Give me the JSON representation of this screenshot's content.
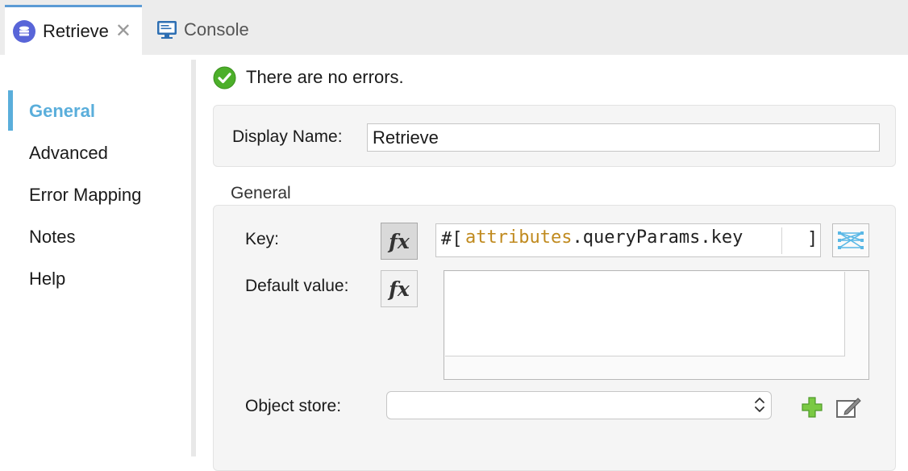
{
  "tabs": [
    {
      "label": "Retrieve",
      "icon": "object-store-icon",
      "active": true,
      "close_glyph": "✕"
    },
    {
      "label": "Console",
      "icon": "console-monitor-icon",
      "active": false
    }
  ],
  "sidebar": {
    "items": [
      {
        "label": "General",
        "selected": true
      },
      {
        "label": "Advanced",
        "selected": false
      },
      {
        "label": "Error Mapping",
        "selected": false
      },
      {
        "label": "Notes",
        "selected": false
      },
      {
        "label": "Help",
        "selected": false
      }
    ]
  },
  "status": {
    "text": "There are no errors.",
    "icon": "check-circle-icon"
  },
  "display_name": {
    "label": "Display Name:",
    "value": "Retrieve"
  },
  "general_section": {
    "title": "General",
    "key": {
      "label": "Key:",
      "fx_label": "fx",
      "prefix": "#[",
      "expr_token1": "attributes",
      "expr_token2": ".queryParams.key",
      "suffix": "]"
    },
    "default_value": {
      "label": "Default value:",
      "fx_label": "fx",
      "value": ""
    },
    "object_store": {
      "label": "Object store:",
      "selected": ""
    }
  },
  "colors": {
    "accent": "#5aaedb",
    "expression_keyword": "#c08a1e",
    "success_green": "#4caf2a",
    "tab_icon_purple": "#5865d8"
  }
}
